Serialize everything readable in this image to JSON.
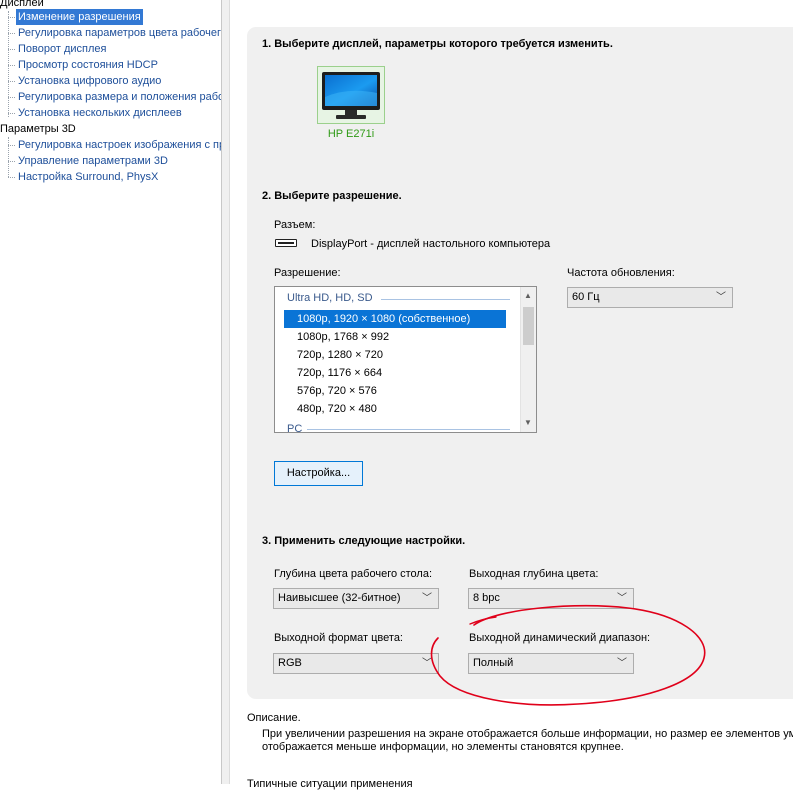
{
  "tree": {
    "categories": [
      {
        "label": "Дисплей"
      },
      {
        "label": "Параметры 3D"
      }
    ],
    "display_items": [
      {
        "label": "Изменение разрешения",
        "selected": true
      },
      {
        "label": "Регулировка параметров цвета рабочег"
      },
      {
        "label": "Поворот дисплея"
      },
      {
        "label": "Просмотр состояния HDCP"
      },
      {
        "label": "Установка цифрового аудио"
      },
      {
        "label": "Регулировка размера и положения рабо"
      },
      {
        "label": "Установка нескольких дисплеев"
      }
    ],
    "three_d_items": [
      {
        "label": "Регулировка настроек изображения с пр"
      },
      {
        "label": "Управление параметрами 3D"
      },
      {
        "label": "Настройка Surround, PhysX"
      }
    ]
  },
  "section1": {
    "heading": "1. Выберите дисплей, параметры которого требуется изменить.",
    "monitor_name": "HP E271i"
  },
  "section2": {
    "heading": "2. Выберите разрешение.",
    "connector_label": "Разъем:",
    "connector_value": "DisplayPort - дисплей настольного компьютера",
    "resolution_label": "Разрешение:",
    "refresh_label": "Частота обновления:",
    "refresh_value": "60 Гц",
    "groups": [
      {
        "label": "Ultra HD, HD, SD"
      },
      {
        "label": "PC"
      }
    ],
    "resolutions": [
      {
        "label": "1080p, 1920 × 1080 (собственное)",
        "selected": true
      },
      {
        "label": "1080p, 1768 × 992"
      },
      {
        "label": "720p, 1280 × 720"
      },
      {
        "label": "720p, 1176 × 664"
      },
      {
        "label": "576p, 720 × 576"
      },
      {
        "label": "480p, 720 × 480"
      }
    ],
    "setup_button": "Настройка..."
  },
  "section3": {
    "heading": "3. Применить следующие настройки.",
    "desktop_depth_label": "Глубина цвета рабочего стола:",
    "desktop_depth_value": "Наивысшее (32-битное)",
    "output_depth_label": "Выходная глубина цвета:",
    "output_depth_value": "8 bpc",
    "output_format_label": "Выходной формат цвета:",
    "output_format_value": "RGB",
    "dynamic_range_label": "Выходной динамический диапазон:",
    "dynamic_range_value": "Полный"
  },
  "description": {
    "title": "Описание.",
    "line1": "При увеличении разрешения на экране отображается больше информации, но размер ее элементов умен",
    "line2": "отображается меньше информации, но элементы становятся крупнее.",
    "typical": "Типичные ситуации применения"
  },
  "colors": {
    "accent": "#0a74d6",
    "tree_link": "#1e4f9a",
    "monitor_label": "#2f9a16",
    "annotation": "#e0001a"
  },
  "icons": {
    "monitor": "monitor-icon",
    "connector": "displayport-icon",
    "dropdown": "chevron-down-icon"
  }
}
